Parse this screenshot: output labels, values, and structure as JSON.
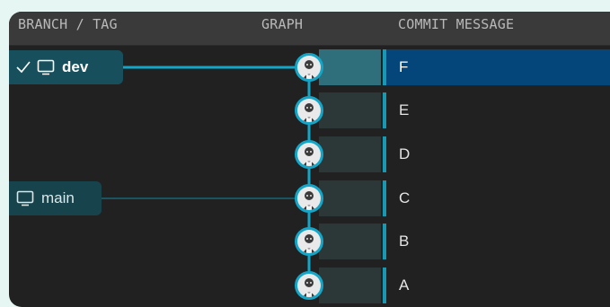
{
  "columns": {
    "branch_tag": "BRANCH / TAG",
    "graph": "GRAPH",
    "commit_message": "COMMIT MESSAGE"
  },
  "branches": [
    {
      "name": "dev",
      "checked_out": true
    },
    {
      "name": "main",
      "checked_out": false
    }
  ],
  "commits": [
    {
      "message": "F",
      "selected": true,
      "branch": "dev"
    },
    {
      "message": "E",
      "selected": false
    },
    {
      "message": "D",
      "selected": false
    },
    {
      "message": "C",
      "selected": false,
      "branch": "main"
    },
    {
      "message": "B",
      "selected": false
    },
    {
      "message": "A",
      "selected": false
    }
  ],
  "icons": {
    "checkmark": "check-icon",
    "branch": "monitor-icon",
    "commit_author": "avatar-icon"
  },
  "colors": {
    "accent": "#14a6c8",
    "selected_row": "#05467a",
    "branch_pill": "#17505c",
    "background": "#212121"
  }
}
